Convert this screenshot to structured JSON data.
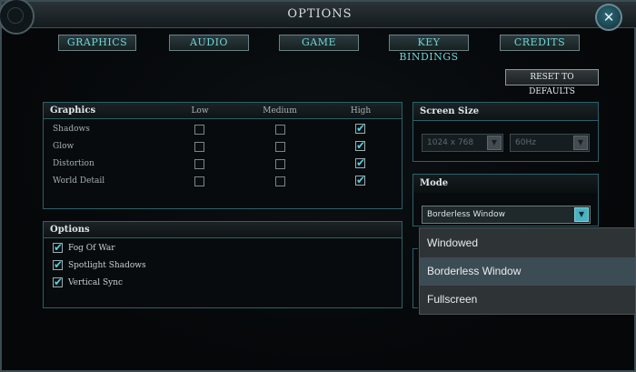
{
  "window": {
    "title": "OPTIONS",
    "close_glyph": "✕"
  },
  "tabs": [
    {
      "label": "GRAPHICS"
    },
    {
      "label": "AUDIO"
    },
    {
      "label": "GAME"
    },
    {
      "label": "KEY BINDINGS"
    },
    {
      "label": "CREDITS"
    }
  ],
  "reset_button": "RESET TO DEFAULTS",
  "graphics_panel": {
    "title": "Graphics",
    "columns": [
      "Low",
      "Medium",
      "High"
    ],
    "rows": [
      {
        "label": "Shadows",
        "selected": "High"
      },
      {
        "label": "Glow",
        "selected": "High"
      },
      {
        "label": "Distortion",
        "selected": "High"
      },
      {
        "label": "World Detail",
        "selected": "High"
      }
    ]
  },
  "options_panel": {
    "title": "Options",
    "items": [
      {
        "label": "Fog Of War",
        "checked": true
      },
      {
        "label": "Spotlight Shadows",
        "checked": true
      },
      {
        "label": "Vertical Sync",
        "checked": true
      }
    ]
  },
  "screen_size_panel": {
    "title": "Screen Size",
    "resolution": "1024 x 768",
    "refresh_rate": "60Hz"
  },
  "mode_panel": {
    "title": "Mode",
    "current": "Borderless Window",
    "options": [
      "Windowed",
      "Borderless Window",
      "Fullscreen"
    ],
    "highlighted": "Borderless Window"
  },
  "icons": {
    "checkmark": "✔",
    "dropdown_arrow": "▼"
  }
}
